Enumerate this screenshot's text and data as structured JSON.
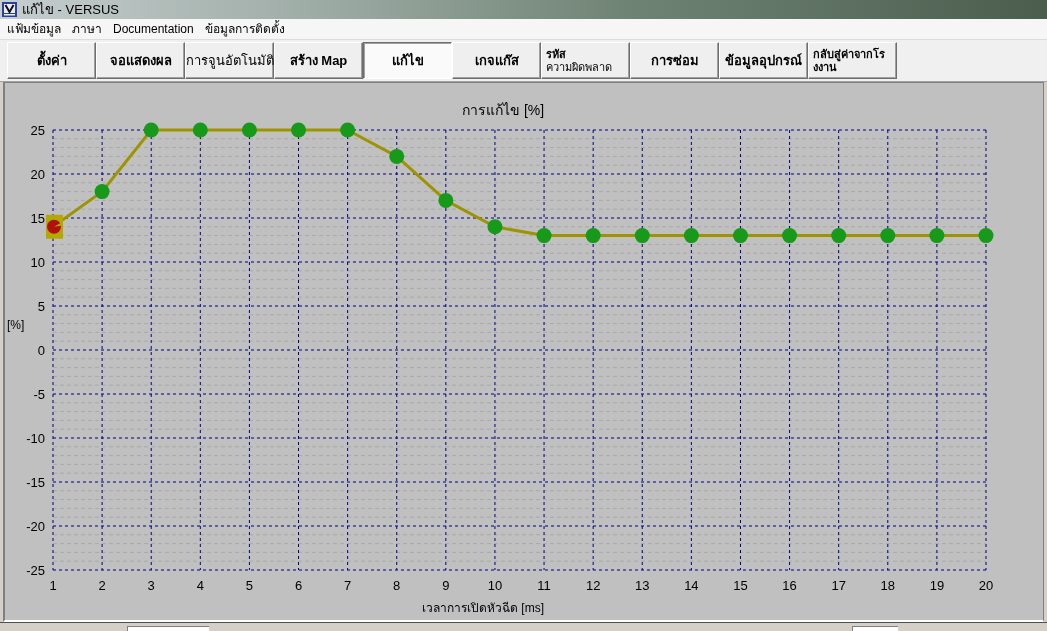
{
  "window": {
    "title": "แก้ไข - VERSUS"
  },
  "menu": [
    "แฟ้มข้อมูล",
    "ภาษา",
    "Documentation",
    "ข้อมูลการติดตั้ง"
  ],
  "toolbar": [
    {
      "lines": [
        "ตั้งค่า"
      ],
      "bold": true,
      "selected": false
    },
    {
      "lines": [
        "จอแสดงผล"
      ],
      "bold": true,
      "selected": false
    },
    {
      "lines": [
        "การจูนอัตโนมัติ"
      ],
      "bold": false,
      "selected": false
    },
    {
      "lines": [
        "สร้าง Map"
      ],
      "bold": true,
      "selected": false
    },
    {
      "lines": [
        "แก้ไข"
      ],
      "bold": true,
      "selected": true
    },
    {
      "lines": [
        "เกจแก๊ส"
      ],
      "bold": true,
      "selected": false
    },
    {
      "lines": [
        "**รหัส**",
        "ความผิดพลาด"
      ],
      "bold": false,
      "selected": false
    },
    {
      "lines": [
        "การซ่อม"
      ],
      "bold": true,
      "selected": false
    },
    {
      "lines": [
        "ข้อมูลอุปกรณ์"
      ],
      "bold": true,
      "selected": false
    },
    {
      "lines": [
        "กลับสู่ค่าจากโร",
        "งงาน"
      ],
      "bold": true,
      "selected": false
    }
  ],
  "chart": {
    "chart_data": {
      "type": "line",
      "title": "การแก้ไข [%]",
      "xlabel": "เวลาการเปิดหัวฉีด [ms]",
      "ylabel": "[%]",
      "grid": true,
      "x": [
        1,
        2,
        3,
        4,
        5,
        6,
        7,
        8,
        9,
        10,
        11,
        12,
        13,
        14,
        15,
        16,
        17,
        18,
        19,
        20
      ],
      "series": [
        {
          "color": "#9c9400",
          "marker": "circle",
          "values": [
            14,
            18,
            25,
            25,
            25,
            25,
            25,
            22,
            17,
            14,
            13,
            13,
            13,
            13,
            13,
            13,
            13,
            13,
            13,
            13
          ]
        }
      ],
      "xlim": [
        1,
        20
      ],
      "ylim": [
        -25,
        25
      ],
      "xticks": [
        1,
        2,
        3,
        4,
        5,
        6,
        7,
        8,
        9,
        10,
        11,
        12,
        13,
        14,
        15,
        16,
        17,
        18,
        19,
        20
      ],
      "yticks": [
        25,
        20,
        15,
        10,
        5,
        0,
        -5,
        -10,
        -15,
        -20,
        -25
      ]
    },
    "points": [
      {
        "selected": true
      },
      {
        "selected": false
      },
      {
        "selected": false
      },
      {
        "selected": false
      },
      {
        "selected": false
      },
      {
        "selected": false
      },
      {
        "selected": false
      },
      {
        "selected": false
      },
      {
        "selected": false
      },
      {
        "selected": false
      },
      {
        "selected": false
      },
      {
        "selected": false
      },
      {
        "selected": false
      },
      {
        "selected": false
      },
      {
        "selected": false
      },
      {
        "selected": false
      },
      {
        "selected": false
      },
      {
        "selected": false
      },
      {
        "selected": false
      },
      {
        "selected": false
      }
    ]
  }
}
